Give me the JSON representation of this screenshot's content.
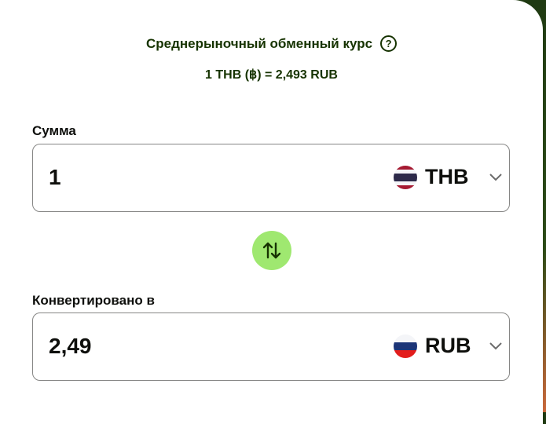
{
  "rate": {
    "title": "Среднерыночный обменный курс",
    "help_icon": "question-icon",
    "value": "1 THB (฿) = 2,493 RUB"
  },
  "from": {
    "label": "Сумма",
    "amount": "1",
    "currency": "THB",
    "flag": "thailand-flag-icon"
  },
  "to": {
    "label": "Конвертировано в",
    "amount": "2,49",
    "currency": "RUB",
    "flag": "russia-flag-icon"
  },
  "swap": {
    "icon": "swap-arrows-icon"
  },
  "colors": {
    "accent": "#9fe870",
    "text_dark_green": "#163300",
    "text": "#0e0f0c",
    "border": "#868685",
    "background_top": "#1f3a12",
    "background_bottom": "#c9673a"
  }
}
